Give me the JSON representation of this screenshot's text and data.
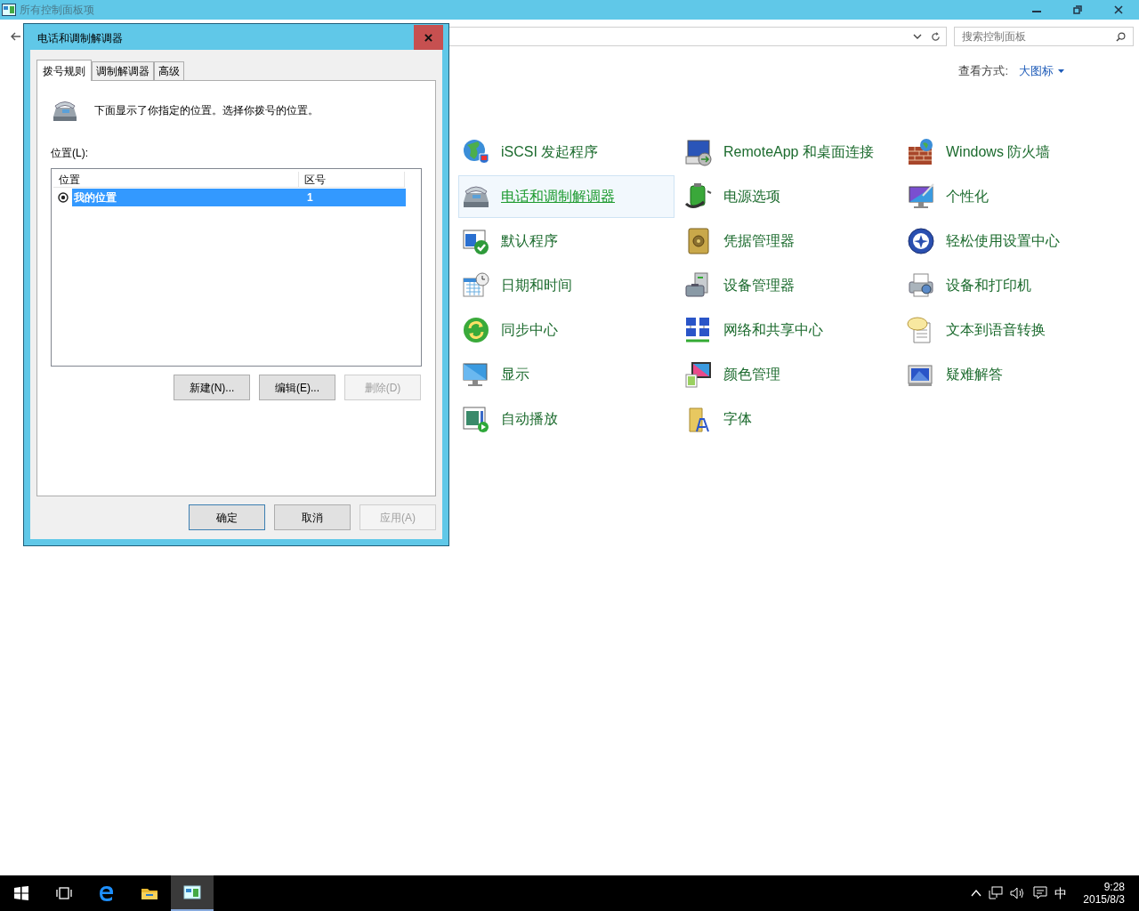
{
  "window": {
    "title": "所有控制面板项"
  },
  "search": {
    "placeholder": "搜索控制面板"
  },
  "view_by": {
    "label": "查看方式:",
    "value": "大图标"
  },
  "items": [
    {
      "label": "iSCSI 发起程序",
      "hovered": false
    },
    {
      "label": "RemoteApp 和桌面连接",
      "hovered": false
    },
    {
      "label": "Windows 防火墙",
      "hovered": false
    },
    {
      "label": "电话和调制解调器",
      "hovered": true
    },
    {
      "label": "电源选项",
      "hovered": false
    },
    {
      "label": "个性化",
      "hovered": false
    },
    {
      "label": "默认程序",
      "hovered": false
    },
    {
      "label": "凭据管理器",
      "hovered": false
    },
    {
      "label": "轻松使用设置中心",
      "hovered": false
    },
    {
      "label": "日期和时间",
      "hovered": false
    },
    {
      "label": "设备管理器",
      "hovered": false
    },
    {
      "label": "设备和打印机",
      "hovered": false
    },
    {
      "label": "同步中心",
      "hovered": false
    },
    {
      "label": "网络和共享中心",
      "hovered": false
    },
    {
      "label": "文本到语音转换",
      "hovered": false
    },
    {
      "label": "显示",
      "hovered": false
    },
    {
      "label": "颜色管理",
      "hovered": false
    },
    {
      "label": "疑难解答",
      "hovered": false
    },
    {
      "label": "自动播放",
      "hovered": false
    },
    {
      "label": "字体",
      "hovered": false
    }
  ],
  "dialog": {
    "title": "电话和调制解调器",
    "tabs": [
      {
        "label": "拨号规则",
        "selected": true
      },
      {
        "label": "调制解调器",
        "selected": false
      },
      {
        "label": "高级",
        "selected": false
      }
    ],
    "description": "下面显示了你指定的位置。选择你拨号的位置。",
    "list_label": "位置(L):",
    "columns": [
      "位置",
      "区号"
    ],
    "rows": [
      {
        "cells": [
          "我的位置",
          "1"
        ],
        "selected": true
      }
    ],
    "actions": [
      {
        "label": "新建(N)...",
        "disabled": false
      },
      {
        "label": "编辑(E)...",
        "disabled": false
      },
      {
        "label": "删除(D)",
        "disabled": true
      }
    ],
    "buttons": [
      {
        "label": "确定",
        "disabled": false,
        "default": true
      },
      {
        "label": "取消",
        "disabled": false,
        "default": false
      },
      {
        "label": "应用(A)",
        "disabled": true,
        "default": false
      }
    ]
  },
  "taskbar": {
    "apps": [
      {
        "active": false
      },
      {
        "active": false
      },
      {
        "active": false
      },
      {
        "active": false
      },
      {
        "active": true
      }
    ],
    "ime": "中",
    "time": "9:28",
    "date": "2015/8/3"
  }
}
